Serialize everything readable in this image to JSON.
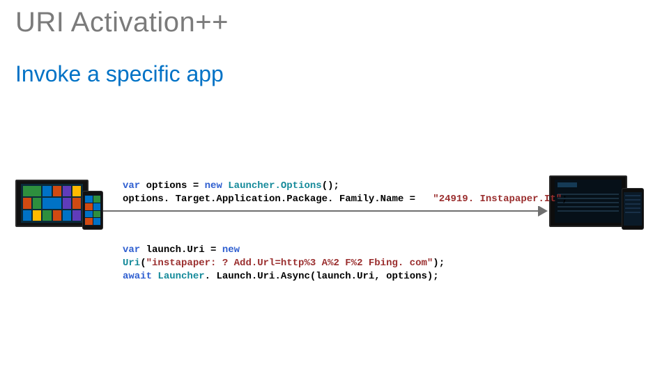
{
  "title": "URI Activation++",
  "subtitle": "Invoke a specific app",
  "code_block_1": {
    "l1a": "var",
    "l1b": " options = ",
    "l1c": "new",
    "l1d": " ",
    "l1e": "Launcher.Options",
    "l1f": "();",
    "l2a": "options. Target.Application.Package. Family.Name = ",
    "l2b": "  ",
    "l2c": "\"24919. Instapaper.It\"",
    "l2d": ";"
  },
  "code_block_2": {
    "l1a": "var",
    "l1b": " launch.Uri = ",
    "l1c": "new",
    "l2a": "Uri",
    "l2b": "(",
    "l2c": "\"instapaper: ? Add.Url=http%3 A%2 F%2 Fbing. com\"",
    "l2d": ");",
    "l3a": "await",
    "l3b": " ",
    "l3c": "Launcher",
    "l3d": ". Launch.Uri.Async(launch.Uri, options);"
  }
}
